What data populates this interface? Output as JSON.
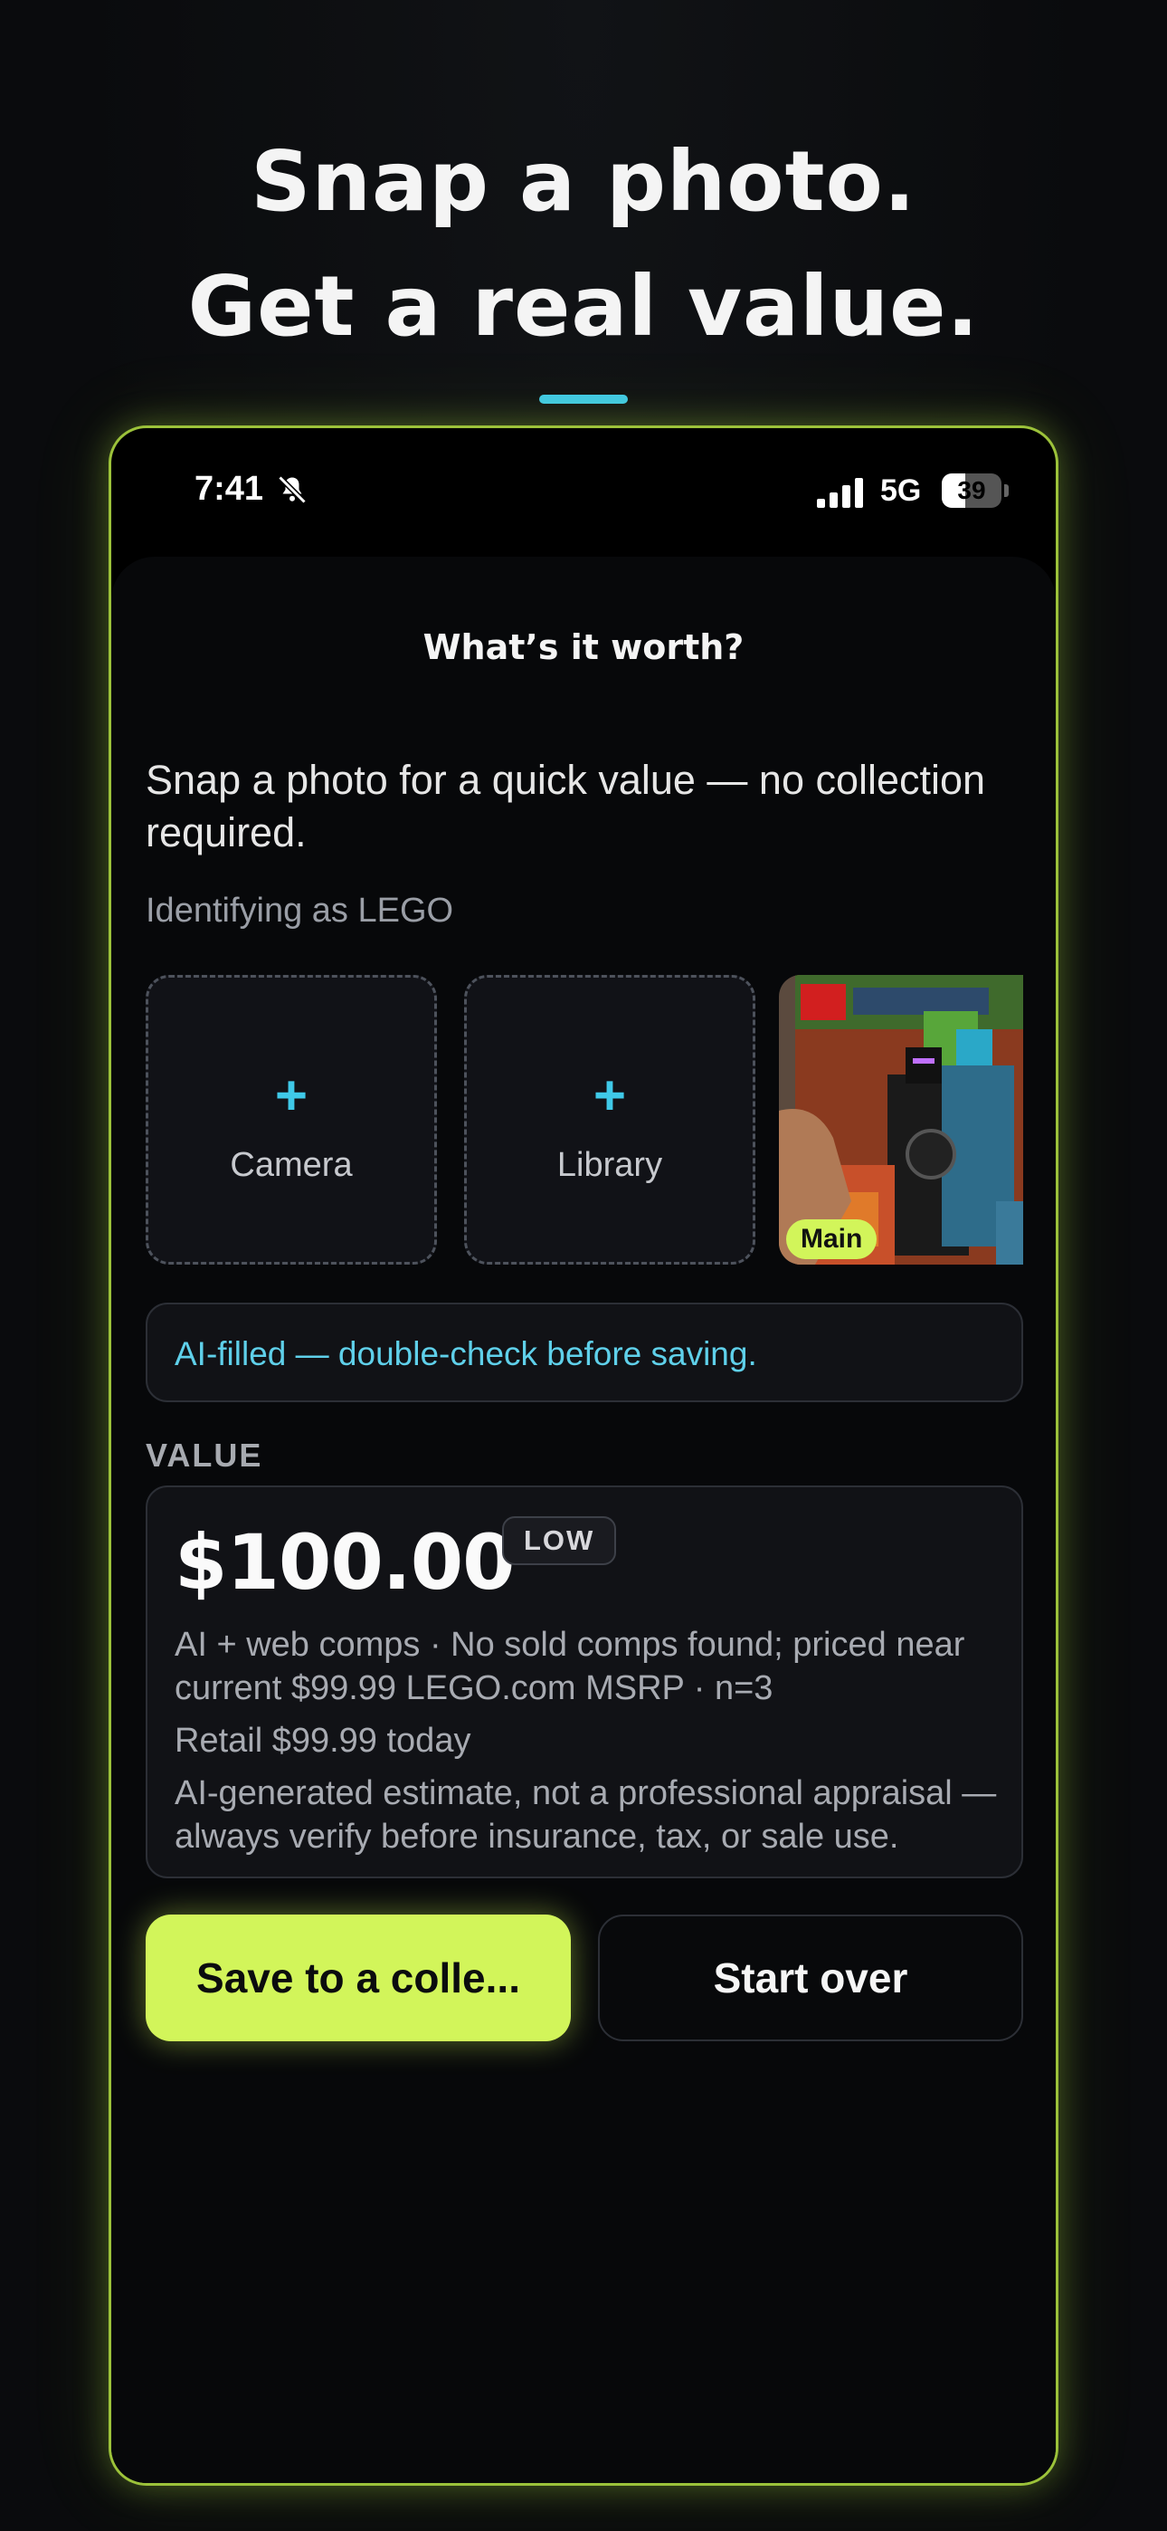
{
  "headline": {
    "line1": "Snap a photo.",
    "line2": "Get a real value."
  },
  "status_bar": {
    "time": "7:41",
    "network": "5G",
    "battery": "39",
    "battery_level": 0.39
  },
  "sheet": {
    "title": "What’s it worth?",
    "intro": "Snap a photo for a quick value — no collection required.",
    "identifying": "Identifying as LEGO"
  },
  "photo_sources": [
    {
      "label": "Camera",
      "icon": "plus-icon"
    },
    {
      "label": "Library",
      "icon": "plus-icon"
    }
  ],
  "photo_thumbnail": {
    "badge": "Main"
  },
  "notice": "AI-filled — double-check before saving.",
  "value_section": {
    "label": "VALUE",
    "price": "$100.00",
    "confidence": "LOW",
    "source_note": "AI + web comps · No sold comps found; priced near current $99.99 LEGO.com MSRP · n=3",
    "retail_note": "Retail $99.99 today",
    "disclaimer": "AI-generated estimate, not a professional appraisal — always verify before insurance, tax, or sale use."
  },
  "actions": {
    "save_label": "Save to a colle...",
    "start_over_label": "Start over"
  },
  "colors": {
    "accent_lime": "#d2f55a",
    "accent_cyan": "#3fc9e8",
    "device_border": "#9cc23a"
  }
}
